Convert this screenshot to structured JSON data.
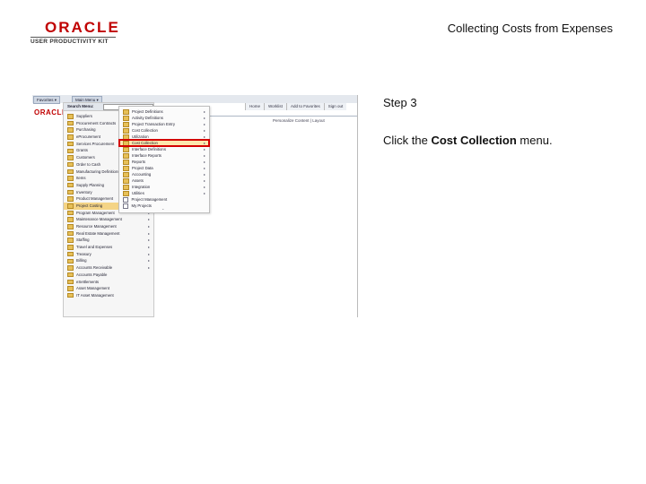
{
  "header": {
    "logo_text": "ORACLE",
    "logo_sub": "USER PRODUCTIVITY KIT",
    "doc_title": "Collecting Costs from Expenses"
  },
  "screenshot": {
    "nav_tabs": [
      "Favorites ▾",
      "Main Menu ▾"
    ],
    "top_links": [
      "Home",
      "Worklist",
      "Add to Favorites",
      "Sign out"
    ],
    "personalize": "Personalize Content | Layout",
    "menu_title": "Search Menu:",
    "menu_items": [
      "Suppliers",
      "Procurement Contracts",
      "Purchasing",
      "eProcurement",
      "Services Procurement",
      "Grants",
      "Customers",
      "Order to Cash",
      "Manufacturing Definitions",
      "Items",
      "Supply Planning",
      "Inventory",
      "Product Management",
      "Project Costing",
      "Program Management",
      "Maintenance Management",
      "Resource Management",
      "Real Estate Management",
      "Staffing",
      "Travel and Expenses",
      "Treasury",
      "Billing",
      "Accounts Receivable",
      "Accounts Payable",
      "eSettlements",
      "Asset Management",
      "IT Asset Management"
    ],
    "highlighted_item_index": 13,
    "submenu_items": [
      "Project Definitions",
      "Activity Definitions",
      "Project Transaction Entry",
      "Cost Collection",
      "Utilization",
      "Cost Collection",
      "Interface Definitions",
      "Interface Reports",
      "Reports",
      "Project Data",
      "Accounting",
      "Assets",
      "Integration",
      "Utilities",
      "Project Management",
      "My Projects"
    ],
    "submenu_target_index": 5,
    "highlight_color": "#f4d486",
    "target_outline_color": "#d40000"
  },
  "instructions": {
    "step": "Step 3",
    "text_before": "Click the ",
    "bold": "Cost Collection",
    "text_after": " menu."
  }
}
